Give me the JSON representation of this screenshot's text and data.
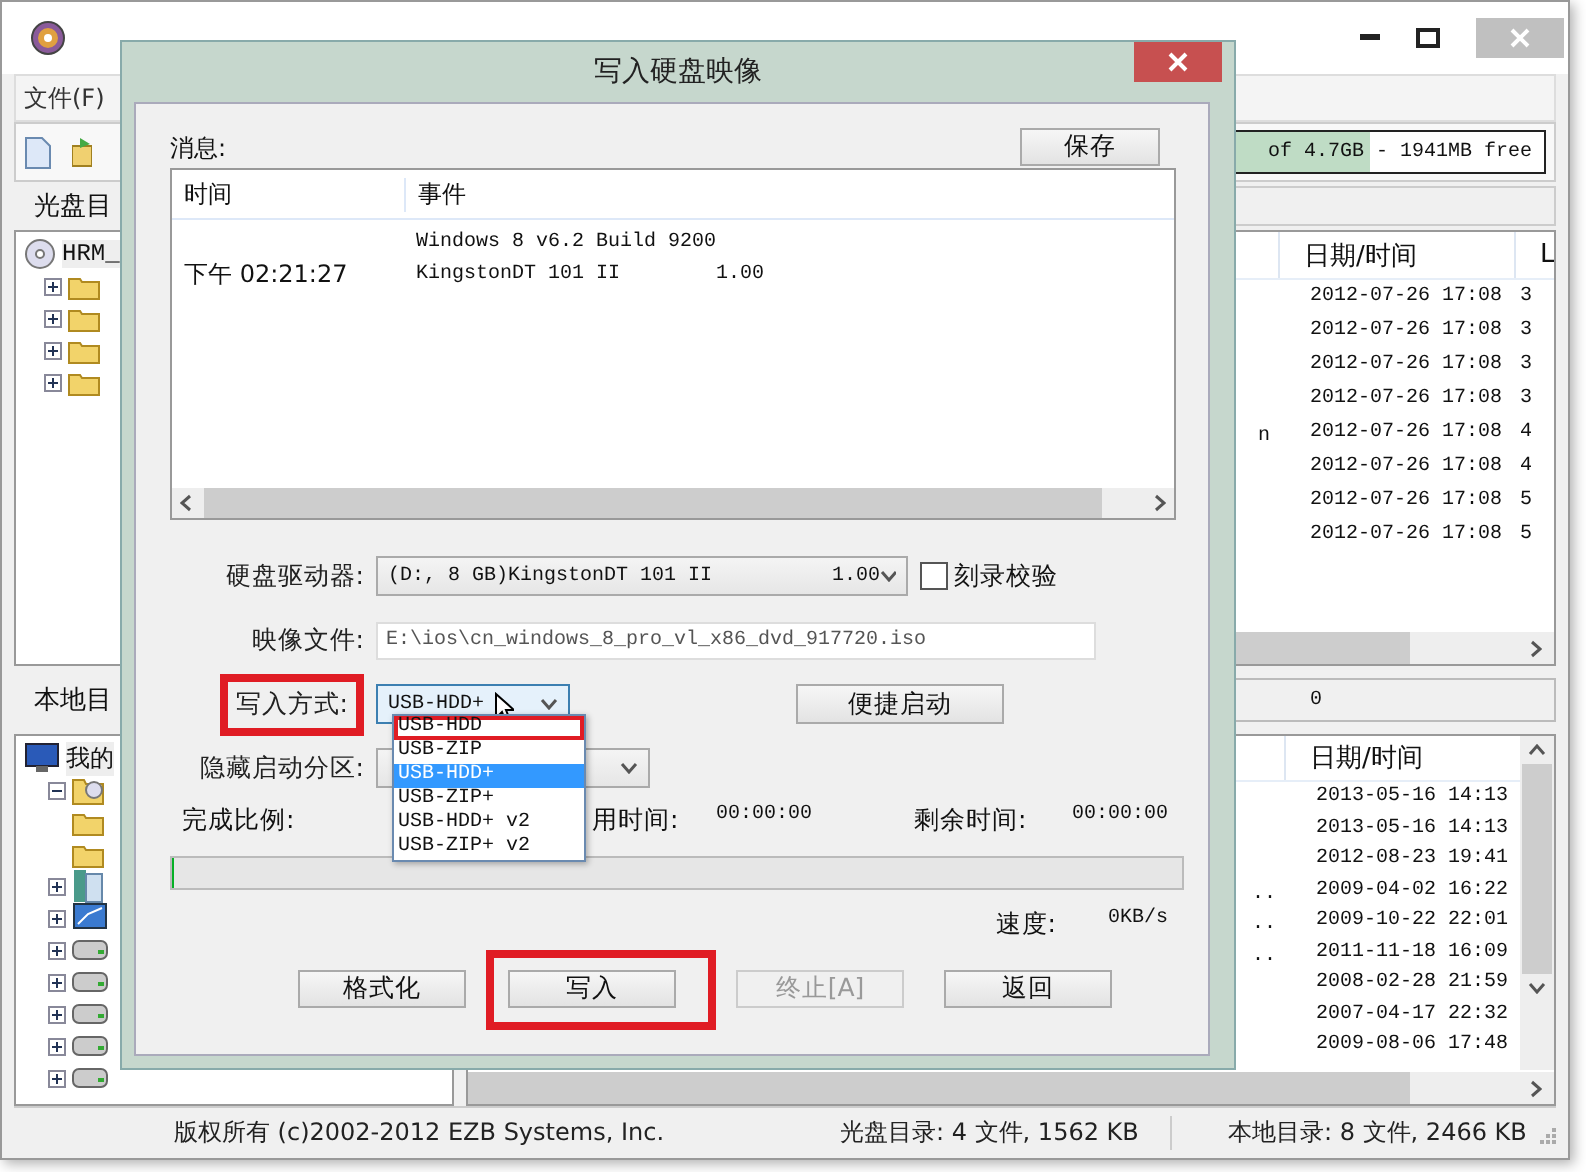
{
  "main_window": {
    "menu": [
      "文件(F)"
    ],
    "cd_panel_label": "光盘目",
    "capacity": {
      "text": "of 4.7GB - 1941MB free",
      "level": 0.75
    },
    "cd_tree": [
      {
        "kind": "disc",
        "label": "HRM_",
        "children": [
          {
            "kind": "folder",
            "expanded": false
          },
          {
            "kind": "folder",
            "expanded": false
          },
          {
            "kind": "folder",
            "expanded": false
          },
          {
            "kind": "folder",
            "expanded": false
          }
        ]
      }
    ],
    "cd_files": {
      "columns": [
        "日期/时间",
        "L"
      ],
      "rows": [
        {
          "date": "2012-07-26 17:08",
          "size": "3"
        },
        {
          "date": "2012-07-26 17:08",
          "size": "3"
        },
        {
          "date": "2012-07-26 17:08",
          "size": "3"
        },
        {
          "date": "2012-07-26 17:08",
          "size": "3"
        },
        {
          "name": "n",
          "date": "2012-07-26 17:08",
          "size": "4"
        },
        {
          "date": "2012-07-26 17:08",
          "size": "4"
        },
        {
          "date": "2012-07-26 17:08",
          "size": "5"
        },
        {
          "date": "2012-07-26 17:08",
          "size": "5"
        }
      ]
    },
    "local_panel_label": "本地目",
    "local_path": "0",
    "local_tree": [
      {
        "kind": "computer",
        "label": "我的",
        "children": [
          {
            "kind": "disc-folder",
            "expanded": true,
            "children": [
              {
                "kind": "folder"
              },
              {
                "kind": "folder"
              }
            ]
          },
          {
            "kind": "library",
            "expanded": false
          },
          {
            "kind": "network",
            "expanded": false
          },
          {
            "kind": "drive",
            "expanded": false
          },
          {
            "kind": "drive",
            "expanded": false
          },
          {
            "kind": "drive",
            "expanded": false
          },
          {
            "kind": "drive",
            "expanded": false
          },
          {
            "kind": "drive",
            "expanded": false
          }
        ]
      }
    ],
    "local_files": {
      "columns": [
        "日期/时间"
      ],
      "rows": [
        {
          "date": "2013-05-16 14:13"
        },
        {
          "date": "2013-05-16 14:13"
        },
        {
          "date": "2012-08-23 19:41"
        },
        {
          "name": "..",
          "date": "2009-04-02 16:22"
        },
        {
          "name": "..",
          "date": "2009-10-22 22:01"
        },
        {
          "name": "..",
          "date": "2011-11-18 16:09"
        },
        {
          "date": "2008-02-28 21:59"
        },
        {
          "date": "2007-04-17 22:32"
        },
        {
          "date": "2009-08-06 17:48"
        }
      ]
    },
    "status_bar": [
      "版权所有 (c)2002-2012 EZB Systems, Inc.",
      "光盘目录: 4 文件, 1562 KB",
      "本地目录: 8 文件, 2466 KB"
    ]
  },
  "dialog": {
    "title": "写入硬盘映像",
    "messages_label": "消息:",
    "save_button": "保存",
    "log": {
      "columns": [
        "时间",
        "事件"
      ],
      "rows": [
        {
          "event": "Windows 8 v6.2 Build 9200"
        },
        {
          "time": "下午 02:21:27",
          "event": "KingstonDT 101 II        1.00"
        }
      ]
    },
    "drive": {
      "label": "硬盘驱动器:",
      "value": "(D:, 8 GB)KingstonDT 101 II          1.00"
    },
    "verify": {
      "label": "刻录校验",
      "checked": false
    },
    "image_file": {
      "label": "映像文件:",
      "value": "E:\\ios\\cn_windows_8_pro_vl_x86_dvd_917720.iso"
    },
    "write_mode": {
      "label": "写入方式:",
      "highlighted": true,
      "value": "USB-HDD+",
      "options": [
        {
          "label": "USB-HDD",
          "selected": false,
          "highlighted": true
        },
        {
          "label": "USB-ZIP",
          "selected": false,
          "highlighted": false
        },
        {
          "label": "USB-HDD+",
          "selected": true,
          "highlighted": false
        },
        {
          "label": "USB-ZIP+",
          "selected": false,
          "highlighted": false
        },
        {
          "label": "USB-HDD+ v2",
          "selected": false,
          "highlighted": false
        },
        {
          "label": "USB-ZIP+ v2",
          "selected": false,
          "highlighted": false
        }
      ]
    },
    "quick_boot_button": "便捷启动",
    "hidden_partition": {
      "label": "隐藏启动分区:"
    },
    "progress": {
      "complete_label": "完成比例:",
      "elapsed_label": "用时间:",
      "elapsed": "00:00:00",
      "remaining_label": "剩余时间:",
      "remaining": "00:00:00",
      "level": 0,
      "speed_label": "速度:",
      "speed": "0KB/s"
    },
    "buttons": [
      {
        "label": "格式化",
        "disabled": false,
        "highlighted": false
      },
      {
        "label": "写入",
        "disabled": false,
        "highlighted": true
      },
      {
        "label": "终止[A]",
        "disabled": true,
        "highlighted": false
      },
      {
        "label": "返回",
        "disabled": false,
        "highlighted": false
      }
    ]
  }
}
